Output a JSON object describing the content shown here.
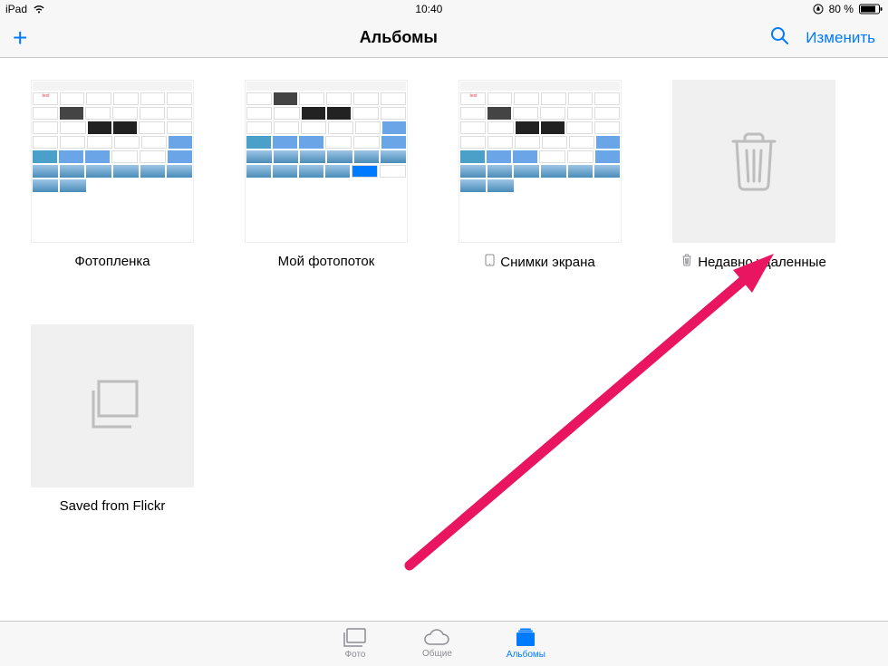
{
  "status": {
    "device": "iPad",
    "time": "10:40",
    "battery": "80 %"
  },
  "nav": {
    "title": "Альбомы",
    "edit": "Изменить"
  },
  "albums": [
    {
      "title": "Фотопленка",
      "kind": "photos"
    },
    {
      "title": "Мой фотопоток",
      "kind": "photos"
    },
    {
      "title": "Снимки экрана",
      "kind": "photos",
      "icon": "device"
    },
    {
      "title": "Недавно удаленные",
      "kind": "trash",
      "icon": "trash"
    },
    {
      "title": "Saved from Flickr",
      "kind": "flickr"
    }
  ],
  "tabs": {
    "photos": "Фото",
    "shared": "Общие",
    "albums": "Альбомы"
  },
  "colors": {
    "accent": "#007aff",
    "arrow": "#ea1560"
  }
}
